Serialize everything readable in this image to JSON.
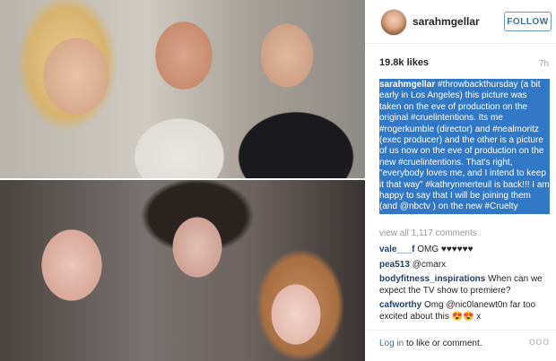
{
  "profile": {
    "username": "sarahmgellar",
    "follow_label": "FOLLOW"
  },
  "stats": {
    "likes": "19.8k likes",
    "time_ago": "7h"
  },
  "caption": {
    "username": "sarahmgellar",
    "text": "#throwbackthursday (a bit early in Los Angeles) this picture was taken on the eve of production on the original #cruelintentions. Its me #rogerkumble (director) and #nealmoritz (exec producer) and the other is a picture of us now on the eve of production on the new #cruelintentions. That's right, \"everybody loves me, and I intend to keep it that way\" #kathrynmerteuil is back!!! I am happy to say that I will be joining them (and @nbctv ) on the new #Cruelty"
  },
  "comments": {
    "view_all": "view all 1,117 comments",
    "items": [
      {
        "user": "vale___f",
        "text": "OMG ♥♥♥♥♥♥"
      },
      {
        "user": "pea513",
        "text": "@cmarx"
      },
      {
        "user": "bodyfitness_inspirations",
        "text": "When can we expect the TV show to premiere?"
      },
      {
        "user": "cafworthy",
        "text": "Omg @nic0lanewt0n far too excited about this 😍😍 x"
      }
    ]
  },
  "footer": {
    "login_link": "Log in",
    "login_rest": " to like or comment.",
    "more_icon": "ooo"
  },
  "colors": {
    "link_blue": "#3f729b",
    "highlight": "#3178c6"
  }
}
